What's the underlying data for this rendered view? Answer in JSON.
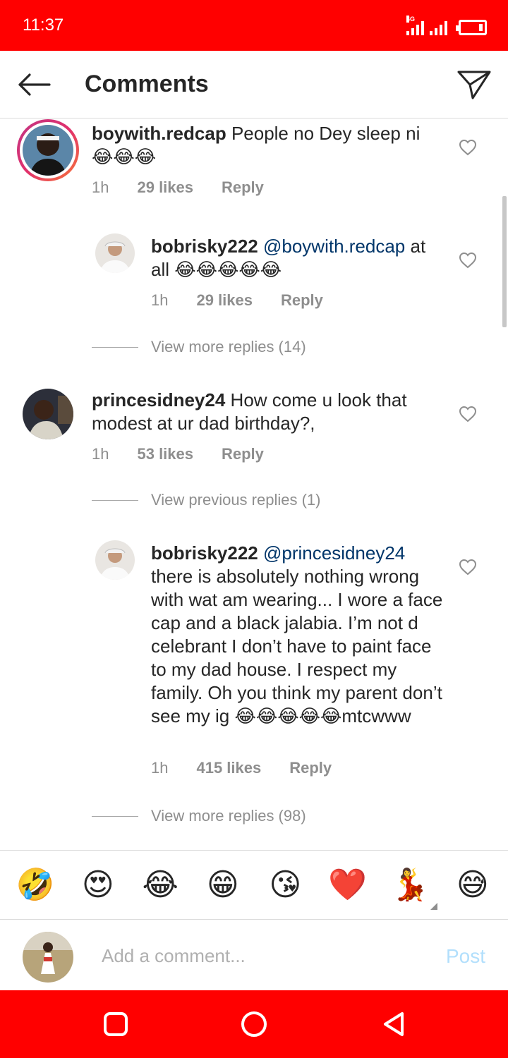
{
  "status_bar": {
    "time": "11:37",
    "network": "4G"
  },
  "header": {
    "title": "Comments"
  },
  "comments": [
    {
      "username": "boywith.redcap",
      "text": "People no Dey sleep ni 😂😂😂",
      "time": "1h",
      "likes": "29 likes",
      "reply": "Reply"
    },
    {
      "username": "bobrisky222",
      "mention": "@boywith.redcap",
      "text": "at all 😂😂😂😂😂",
      "time": "1h",
      "likes": "29 likes",
      "reply": "Reply"
    },
    {
      "username": "princesidney24",
      "text": "How come u look that modest at ur dad birthday?,",
      "time": "1h",
      "likes": "53 likes",
      "reply": "Reply"
    },
    {
      "username": "bobrisky222",
      "mention": "@princesidney24",
      "text": "there is absolutely nothing wrong with wat am wearing... I wore a face cap and a black jalabia. I’m not d celebrant I don’t have to paint face to my dad house. I respect my family. Oh you think my parent don’t see my ig 😂😂😂😂😂mtcwww",
      "time": "1h",
      "likes": "415 likes",
      "reply": "Reply"
    }
  ],
  "view_replies": [
    "View more replies (14)",
    "View previous replies (1)",
    "View more replies (98)"
  ],
  "emoji_bar": [
    "🤣",
    "😍",
    "😂",
    "😁",
    "😘",
    "❤️",
    "💃",
    "😅"
  ],
  "composer": {
    "placeholder": "Add a comment...",
    "post_label": "Post"
  },
  "colors": {
    "status_bar": "#ff0000",
    "mention": "#003569",
    "post_disabled": "#b2dffc",
    "meta_gray": "#8e8e8e"
  }
}
